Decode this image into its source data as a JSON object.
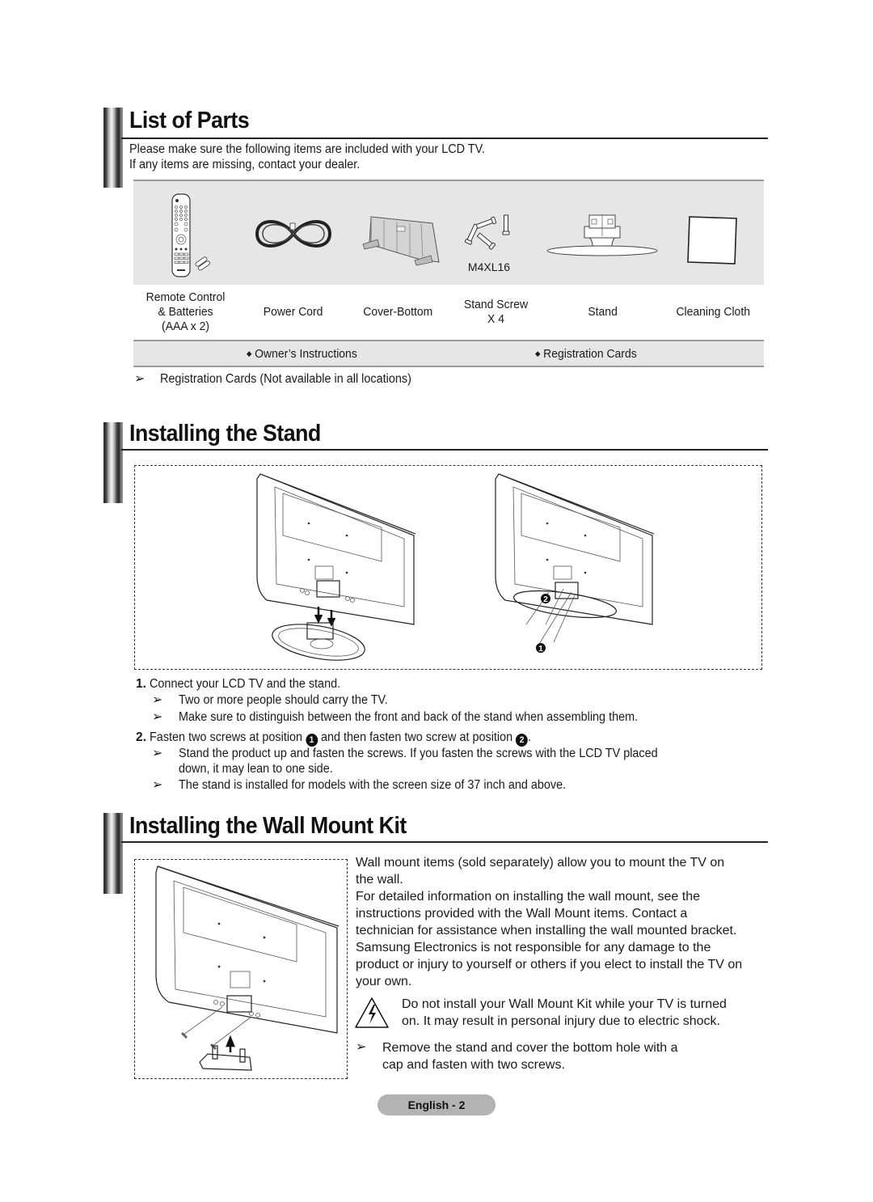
{
  "list_of_parts": {
    "title": "List of Parts",
    "intro_lines": [
      "Please make sure the following items are included with your LCD TV.",
      "If any items are missing, contact your dealer."
    ],
    "parts": [
      {
        "icon": "remote-control-icon",
        "label_lines": [
          "Remote Control",
          "& Batteries",
          "(AAA x 2)"
        ]
      },
      {
        "icon": "power-cord-icon",
        "label_lines": [
          "Power Cord"
        ]
      },
      {
        "icon": "cover-bottom-icon",
        "label_lines": [
          "Cover-Bottom"
        ]
      },
      {
        "icon": "stand-screw-icon",
        "image_caption": "M4XL16",
        "label_lines": [
          "Stand Screw",
          "X 4"
        ]
      },
      {
        "icon": "stand-icon",
        "label_lines": [
          "Stand"
        ]
      },
      {
        "icon": "cleaning-cloth-icon",
        "label_lines": [
          "Cleaning Cloth"
        ]
      }
    ],
    "documents": [
      "Owner’s Instructions",
      "Registration Cards"
    ],
    "note": "Registration Cards (Not available in all locations)"
  },
  "installing_stand": {
    "title": "Installing the Stand",
    "figure_markers": [
      "❶",
      "❷"
    ],
    "steps": [
      {
        "number": "1.",
        "text": "Connect your LCD TV and the stand.",
        "notes": [
          "Two or more people should carry the TV.",
          "Make sure to distinguish between the front and back of the stand when assembling them."
        ]
      },
      {
        "number": "2.",
        "text_before": "Fasten two screws at position",
        "marker1": "1",
        "text_middle": "and then fasten two screw at position",
        "marker2": "2",
        "text_after": ".",
        "notes": [
          "Stand the product up and fasten the screws. If you fasten the screws with the LCD TV placed",
          "down, it may lean to one side.",
          "The stand is installed for models with the screen size of 37 inch and above."
        ]
      }
    ]
  },
  "wall_mount": {
    "title": "Installing the Wall Mount Kit",
    "paragraph_lines": [
      "Wall mount items (sold separately) allow you to mount the TV on",
      "the wall.",
      "For detailed information on installing the wall mount, see the",
      "instructions provided with the Wall Mount items. Contact a",
      "technician for assistance when installing the wall mounted bracket.",
      "Samsung Electronics is not responsible for any damage to the",
      "product or injury to yourself or others if you elect to install the TV on",
      "your own."
    ],
    "warning_lines": [
      "Do not install your Wall Mount Kit while your TV is turned",
      "on. It may result in personal injury due to electric shock."
    ],
    "note_lines": [
      "Remove the stand and cover the bottom hole with a",
      "cap and fasten with two screws."
    ]
  },
  "footer": {
    "page_label": "English - 2"
  },
  "symbols": {
    "note_arrow": "➢",
    "bullet": "◆"
  }
}
